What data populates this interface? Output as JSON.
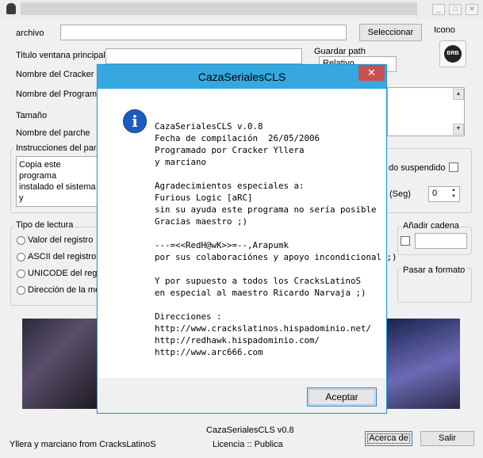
{
  "window": {
    "title_icon": "app-icon",
    "btn_min": "_",
    "btn_max": "□",
    "btn_close": "✕"
  },
  "form": {
    "archivo_label": "archivo",
    "seleccionar_button": "Seleccionar",
    "icono_label": "Icono",
    "icono_badge": "BRB",
    "titulo_label": "Titulo ventana principal",
    "guardar_path_label": "Guardar path",
    "guardar_path_value": "Relativo",
    "cracker_label": "Nombre del Cracker",
    "programa_label": "Nombre del Programa",
    "tamano_label": "Tamaño",
    "parche_label": "Nombre del parche",
    "instrucciones_label": "Instrucciones del parc",
    "instrucciones_text_1": "Copia este programa",
    "instrucciones_text_2": "instalado el sistema y",
    "suspendido_label": "do suspendido",
    "seg_label": "(Seg)",
    "seg_value": "0",
    "tipo_lectura_label": "Tipo de lectura",
    "radio_1": "Valor del registro",
    "radio_2": "ASCII del registro",
    "radio_3": "UNICODE del regis",
    "radio_4": "Dirección de la me",
    "anadir_cadena_label": "Añadir cadena",
    "pasar_formato_label": "Pasar a formato"
  },
  "footer": {
    "credits": "Yllera y marciano from CracksLatinoS",
    "version": "CazaSerialesCLS v0.8",
    "licencia": "Licencia :: Publica",
    "acerca_button": "Acerca de",
    "salir_button": "Salir"
  },
  "dialog": {
    "title": "CazaSerialesCLS",
    "close": "✕",
    "icon": "i",
    "lines": [
      "CazaSerialesCLS v.0.8",
      "Fecha de compilación  26/05/2006",
      "Programado por Cracker Yllera",
      "y marciano",
      "",
      "Agradecimientos especiales a:",
      "Furious Logic [aRC]",
      "sin su ayuda este programa no sería posible",
      "Gracias maestro ;)",
      "",
      "---=<<RedH@wK>>=--,Arapumk",
      "por sus colaboraciónes y apoyo incondicional ;)",
      "",
      "Y por supuesto a todos los CracksLatinoS",
      "en especial al maestro Ricardo Narvaja ;)",
      "",
      "Direcciones :",
      "http://www.crackslatinos.hispadominio.net/",
      "http://redhawk.hispadominio.com/",
      "http://www.arc666.com"
    ],
    "ok_button": "Aceptar"
  }
}
